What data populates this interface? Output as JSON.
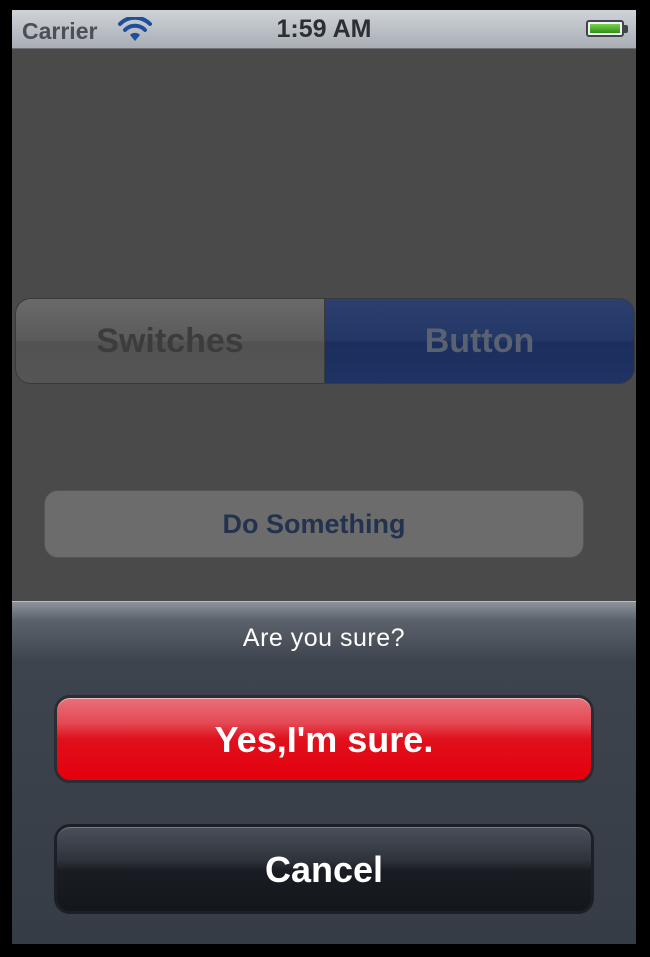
{
  "status_bar": {
    "carrier": "Carrier",
    "time": "1:59 AM",
    "wifi_icon": "wifi-icon",
    "battery_icon": "battery-icon",
    "battery_level": 1.0
  },
  "segmented_control": {
    "segments": [
      {
        "label": "Switches",
        "selected": false
      },
      {
        "label": "Button",
        "selected": true
      }
    ],
    "selected_color": "#233766"
  },
  "main": {
    "do_something_label": "Do Something"
  },
  "action_sheet": {
    "title": "Are you sure?",
    "destructive_label": "Yes,I'm sure.",
    "cancel_label": "Cancel",
    "destructive_color": "#e4000c"
  }
}
